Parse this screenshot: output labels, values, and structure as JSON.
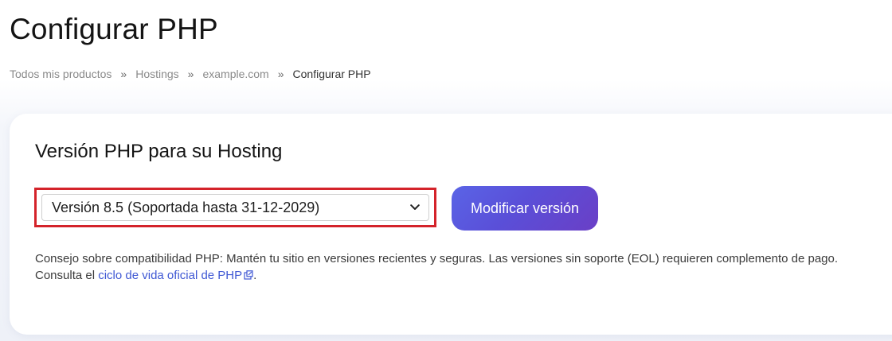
{
  "page_title": "Configurar PHP",
  "breadcrumb": {
    "items": [
      "Todos mis productos",
      "Hostings",
      "example.com"
    ],
    "separator": "»",
    "current": "Configurar PHP"
  },
  "card": {
    "title": "Versión PHP para su Hosting",
    "select": {
      "selected": "Versión 8.5 (Soportada hasta 31-12-2029)"
    },
    "button_label": "Modificar versión",
    "tip": {
      "line1": "Consejo sobre compatibilidad PHP: Mantén tu sitio en versiones recientes y seguras. Las versiones sin soporte (EOL) requieren complemento de pago.",
      "line2_prefix": "Consulta el ",
      "link_text": "ciclo de vida oficial de PHP",
      "line2_suffix": "."
    }
  },
  "icons": {
    "select_chevron": "chevron-down-icon",
    "link_icon": "external-link-icon"
  },
  "colors": {
    "highlight_border": "#d4232a",
    "button_gradient_start": "#5a64e6",
    "button_gradient_end": "#6a3fc6",
    "link": "#3f58d4"
  }
}
